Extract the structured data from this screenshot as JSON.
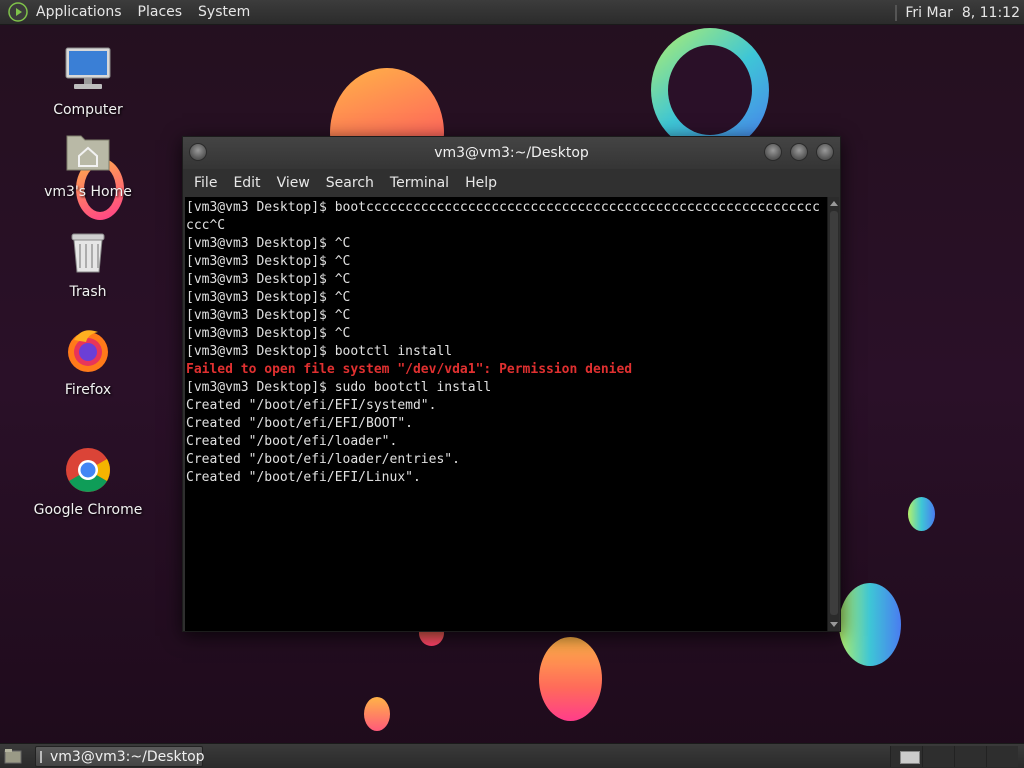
{
  "top_panel": {
    "menus": [
      "Applications",
      "Places",
      "System"
    ],
    "clock": "Fri Mar  8, 11:12"
  },
  "desktop_icons": [
    {
      "label": "Computer",
      "icon": "computer-icon"
    },
    {
      "label": "vm3's Home",
      "icon": "home-folder-icon"
    },
    {
      "label": "Trash",
      "icon": "trash-icon"
    },
    {
      "label": "Firefox",
      "icon": "firefox-icon"
    },
    {
      "label": "Google Chrome",
      "icon": "chrome-icon"
    }
  ],
  "terminal": {
    "title": "vm3@vm3:~/Desktop",
    "menus": [
      "File",
      "Edit",
      "View",
      "Search",
      "Terminal",
      "Help"
    ],
    "lines": [
      {
        "text": "[vm3@vm3 Desktop]$ bootcccccccccccccccccccccccccccccccccccccccccccccccccccccccccc",
        "type": "normal"
      },
      {
        "text": "ccc^C",
        "type": "normal"
      },
      {
        "text": "[vm3@vm3 Desktop]$ ^C",
        "type": "normal"
      },
      {
        "text": "[vm3@vm3 Desktop]$ ^C",
        "type": "normal"
      },
      {
        "text": "[vm3@vm3 Desktop]$ ^C",
        "type": "normal"
      },
      {
        "text": "[vm3@vm3 Desktop]$ ^C",
        "type": "normal"
      },
      {
        "text": "[vm3@vm3 Desktop]$ ^C",
        "type": "normal"
      },
      {
        "text": "[vm3@vm3 Desktop]$ ^C",
        "type": "normal"
      },
      {
        "text": "[vm3@vm3 Desktop]$ bootctl install",
        "type": "normal"
      },
      {
        "text": "Failed to open file system \"/dev/vda1\": Permission denied",
        "type": "error"
      },
      {
        "text": "[vm3@vm3 Desktop]$ sudo bootctl install",
        "type": "normal"
      },
      {
        "text": "Created \"/boot/efi/EFI/systemd\".",
        "type": "normal"
      },
      {
        "text": "Created \"/boot/efi/EFI/BOOT\".",
        "type": "normal"
      },
      {
        "text": "Created \"/boot/efi/loader\".",
        "type": "normal"
      },
      {
        "text": "Created \"/boot/efi/loader/entries\".",
        "type": "normal"
      },
      {
        "text": "Created \"/boot/efi/EFI/Linux\".",
        "type": "normal"
      }
    ]
  },
  "bottom_panel": {
    "task_label": "vm3@vm3:~/Desktop",
    "workspaces": 4,
    "active_workspace": 1
  },
  "colors": {
    "error_text": "#e03030",
    "terminal_bg": "#000000",
    "desktop_bg": "#2a1028"
  }
}
